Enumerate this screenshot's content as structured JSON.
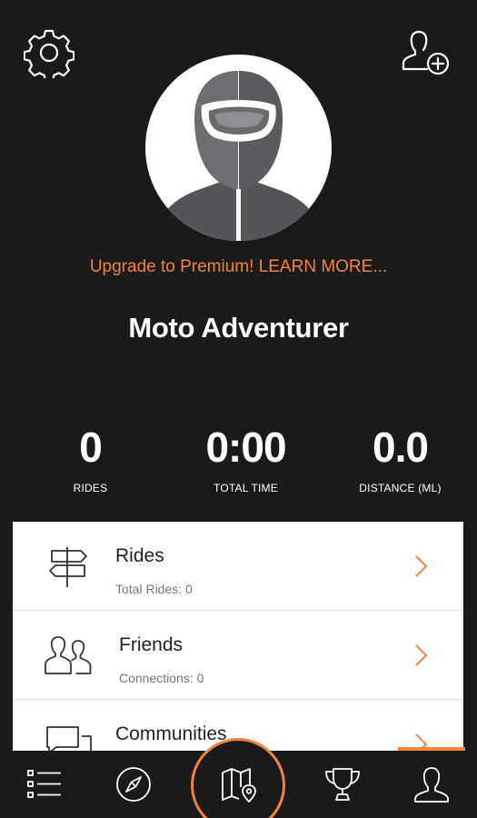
{
  "header": {
    "settings_icon": "gear-icon",
    "add_friend_icon": "add-user-icon"
  },
  "profile": {
    "avatar_icon": "rider-helmet-avatar",
    "promo_text": "Upgrade to Premium! LEARN MORE...",
    "username": "Moto Adventurer"
  },
  "stats": [
    {
      "value": "0",
      "label": "RIDES"
    },
    {
      "value": "0:00",
      "label": "TOTAL TIME"
    },
    {
      "value": "0.0",
      "label": "DISTANCE (ML)"
    }
  ],
  "menu": [
    {
      "title": "Rides",
      "subtitle": "Total Rides: 0",
      "icon": "signpost-icon"
    },
    {
      "title": "Friends",
      "subtitle": "Connections: 0",
      "icon": "friends-icon"
    },
    {
      "title": "Communities",
      "subtitle": "",
      "icon": "communities-icon"
    }
  ],
  "tabs": [
    {
      "icon": "list-icon"
    },
    {
      "icon": "compass-icon"
    },
    {
      "icon": "map-pin-icon"
    },
    {
      "icon": "trophy-icon"
    },
    {
      "icon": "profile-icon"
    }
  ],
  "colors": {
    "background": "#1a1a1a",
    "accent": "#f0843a",
    "card": "#ffffff"
  }
}
